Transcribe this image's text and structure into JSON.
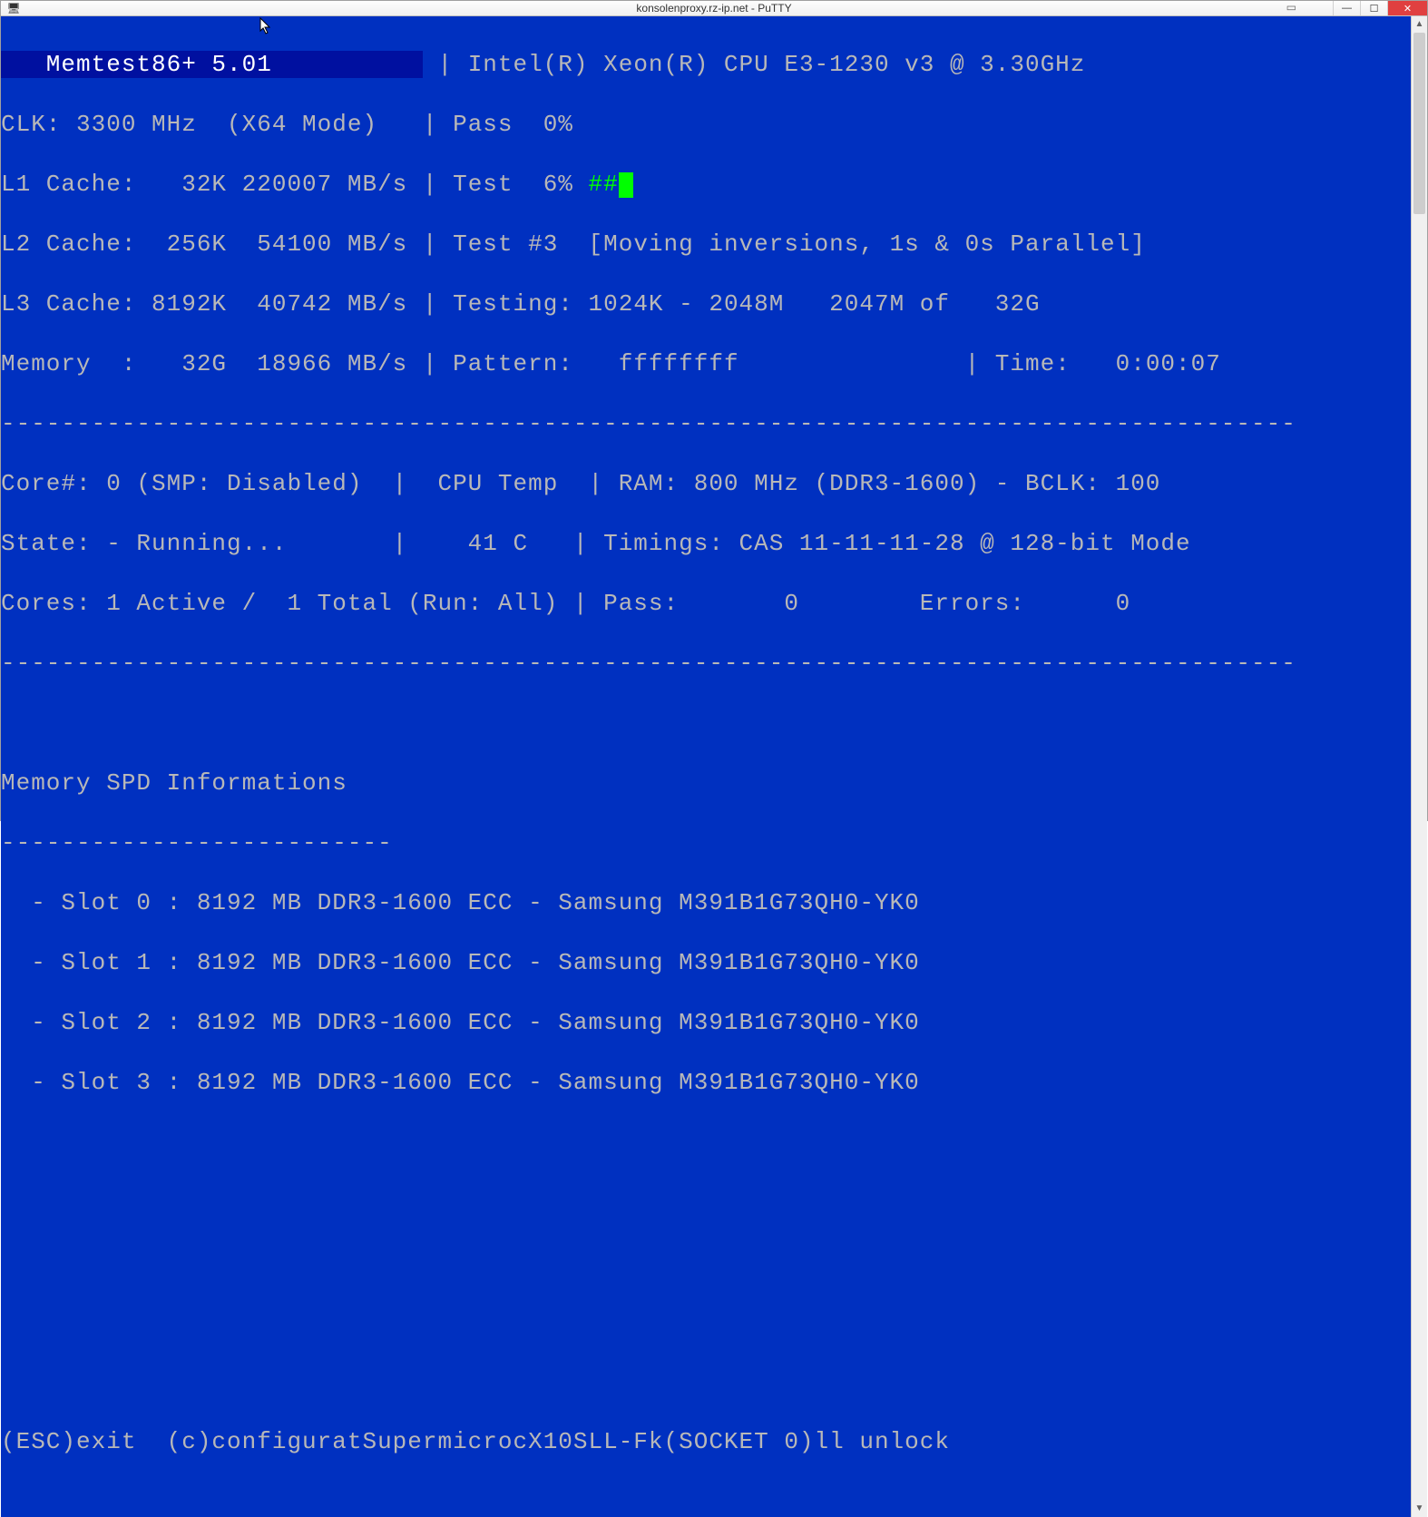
{
  "window": {
    "title": "konsolenproxy.rz-ip.net - PuTTY",
    "app_icon": "🖥"
  },
  "memtest": {
    "title": "   Memtest86+ 5.01          ",
    "cpu": "Intel(R) Xeon(R) CPU E3-1230 v3 @ 3.30GHz",
    "clk": "CLK: 3300 MHz  (X64 Mode)",
    "pass_pct": "Pass  0%",
    "l1": "L1 Cache:   32K 220007 MB/s",
    "test_pct": "Test  6% ",
    "test_bar": "##",
    "l2": "L2 Cache:  256K  54100 MB/s",
    "test_name": "Test #3  [Moving inversions, 1s & 0s Parallel]",
    "l3": "L3 Cache: 8192K  40742 MB/s",
    "testing": "Testing: 1024K - 2048M   2047M of   32G",
    "mem": "Memory  :   32G  18966 MB/s",
    "pattern": "Pattern:   ffffffff",
    "time_label": "| Time:   0:00:07",
    "divider": "--------------------------------------------------------------------------------------",
    "core_line": "Core#: 0 (SMP: Disabled)  |  CPU Temp  | RAM: 800 MHz (DDR3-1600) - BCLK: 100",
    "state_line": "State: - Running...       |    41 C   | Timings: CAS 11-11-11-28 @ 128-bit Mode",
    "cores_line": "Cores: 1 Active /  1 Total (Run: All) | Pass:       0        Errors:      0",
    "spd_header": "Memory SPD Informations",
    "spd_dash": "--------------------------",
    "slots": [
      "  - Slot 0 : 8192 MB DDR3-1600 ECC - Samsung M391B1G73QH0-YK0",
      "  - Slot 1 : 8192 MB DDR3-1600 ECC - Samsung M391B1G73QH0-YK0",
      "  - Slot 2 : 8192 MB DDR3-1600 ECC - Samsung M391B1G73QH0-YK0",
      "  - Slot 3 : 8192 MB DDR3-1600 ECC - Samsung M391B1G73QH0-YK0"
    ],
    "footer": "(ESC)exit  (c)configuratSupermicrocX10SLL-Fk(SOCKET 0)ll unlock"
  }
}
